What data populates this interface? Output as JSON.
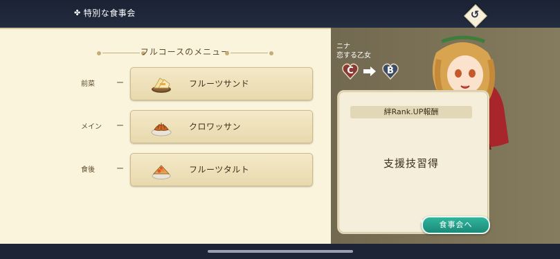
{
  "header": {
    "title": "特別な食事会",
    "title_icon": "✤",
    "back_icon": "↺"
  },
  "menu": {
    "title": "フルコースのメニュー",
    "courses": [
      {
        "label": "前菜",
        "dash": "ー",
        "dish": "フルーツサンド",
        "icon": "fruit-sandwich-icon"
      },
      {
        "label": "メイン",
        "dash": "ー",
        "dish": "クロワッサン",
        "icon": "croissant-icon"
      },
      {
        "label": "食後",
        "dash": "ー",
        "dish": "フルーツタルト",
        "icon": "fruit-tart-icon"
      }
    ]
  },
  "character": {
    "name": "ニナ",
    "title": "恋する乙女"
  },
  "rank": {
    "from": "C",
    "to": "B",
    "from_color": "#8a3a34",
    "to_color": "#3c4d68"
  },
  "reward": {
    "header": "絆Rank.UP報酬",
    "text": "支援技習得"
  },
  "action": {
    "label": "食事会へ"
  },
  "colors": {
    "accent": "#1b8a78",
    "panel": "#fbf4dd",
    "right_bg": "#857b5e"
  }
}
